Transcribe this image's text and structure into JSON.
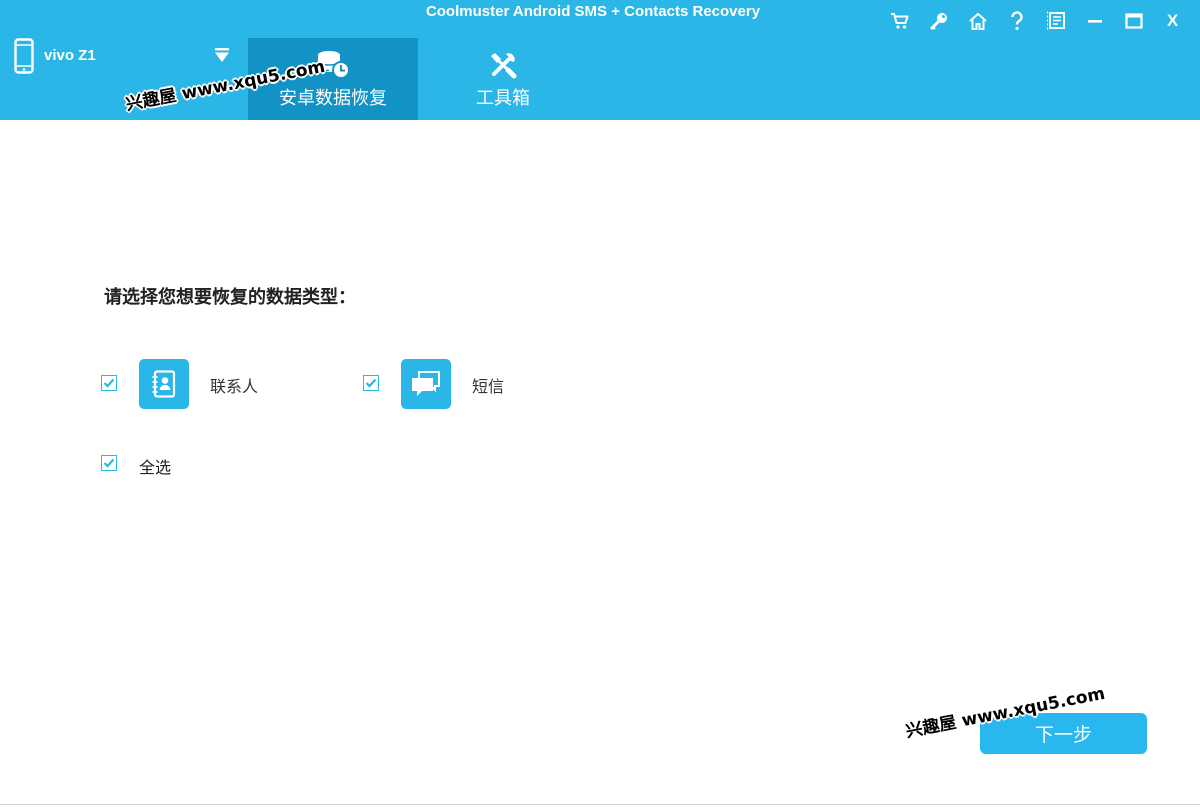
{
  "window": {
    "title": "Coolmuster Android SMS + Contacts Recovery",
    "controls": [
      "cart-icon",
      "key-icon",
      "home-icon",
      "help-icon",
      "feedback-icon",
      "minimize-icon",
      "maximize-icon",
      "close-icon"
    ],
    "close_label": "X"
  },
  "device": {
    "name": "vivo Z1",
    "icon": "phone-icon",
    "dropdown_icon": "triangle-down-icon"
  },
  "tabs": [
    {
      "label": "安卓数据恢复",
      "icon": "data-recovery-icon",
      "active": true
    },
    {
      "label": "工具箱",
      "icon": "tools-icon",
      "active": false
    }
  ],
  "watermark": {
    "text": "兴趣屋 www.xqu5.com"
  },
  "main": {
    "prompt": "请选择您想要恢复的数据类型：",
    "types": [
      {
        "label": "联系人",
        "icon": "contacts-icon",
        "checked": true
      },
      {
        "label": "短信",
        "icon": "messages-icon",
        "checked": true
      }
    ],
    "select_all": {
      "label": "全选",
      "checked": true
    },
    "next_button": "下一步"
  },
  "colors": {
    "header": "#2bb6e8",
    "active_tab": "#1392c6",
    "accent": "#2bb6e8",
    "button": "#29b7ef"
  }
}
